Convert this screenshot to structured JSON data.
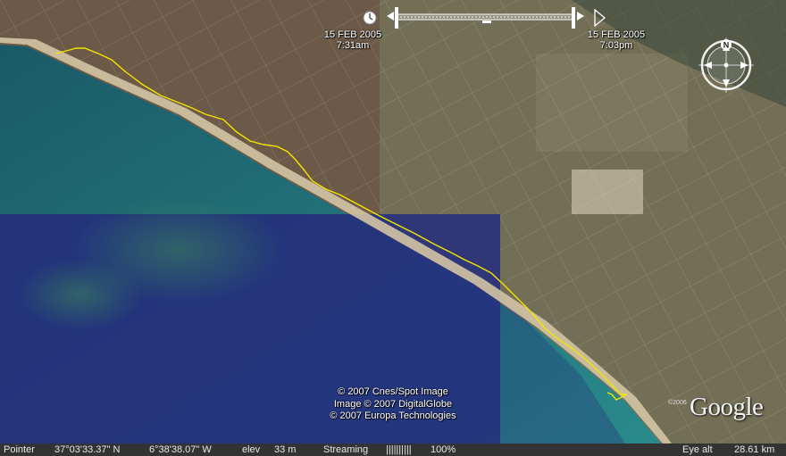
{
  "timeline": {
    "start_date": "15 FEB 2005",
    "start_time": "7:31am",
    "end_date": "15 FEB 2005",
    "end_time": "7:03pm"
  },
  "copyright": {
    "line1": "© 2007 Cnes/Spot Image",
    "line2": "Image © 2007 DigitalGlobe",
    "line3": "© 2007 Europa Technologies"
  },
  "logo": {
    "year": "©2006",
    "text": "Google"
  },
  "compass": {
    "north_label": "N"
  },
  "status": {
    "pointer_label": "Pointer",
    "latitude": "37°03'33.37\" N",
    "longitude": "6°38'38.07\" W",
    "elev_label": "elev",
    "elev_value": "33 m",
    "streaming_label": "Streaming",
    "streaming_bar": "||||||||||",
    "streaming_percent": "100%",
    "eye_alt_label": "Eye alt",
    "eye_alt_value": "28.61 km"
  },
  "colors": {
    "track": "#f2e600",
    "ocean": "#1b6e74",
    "deep_ocean": "#263080",
    "land": "#6f6a55",
    "beach": "#d2c3a3"
  }
}
